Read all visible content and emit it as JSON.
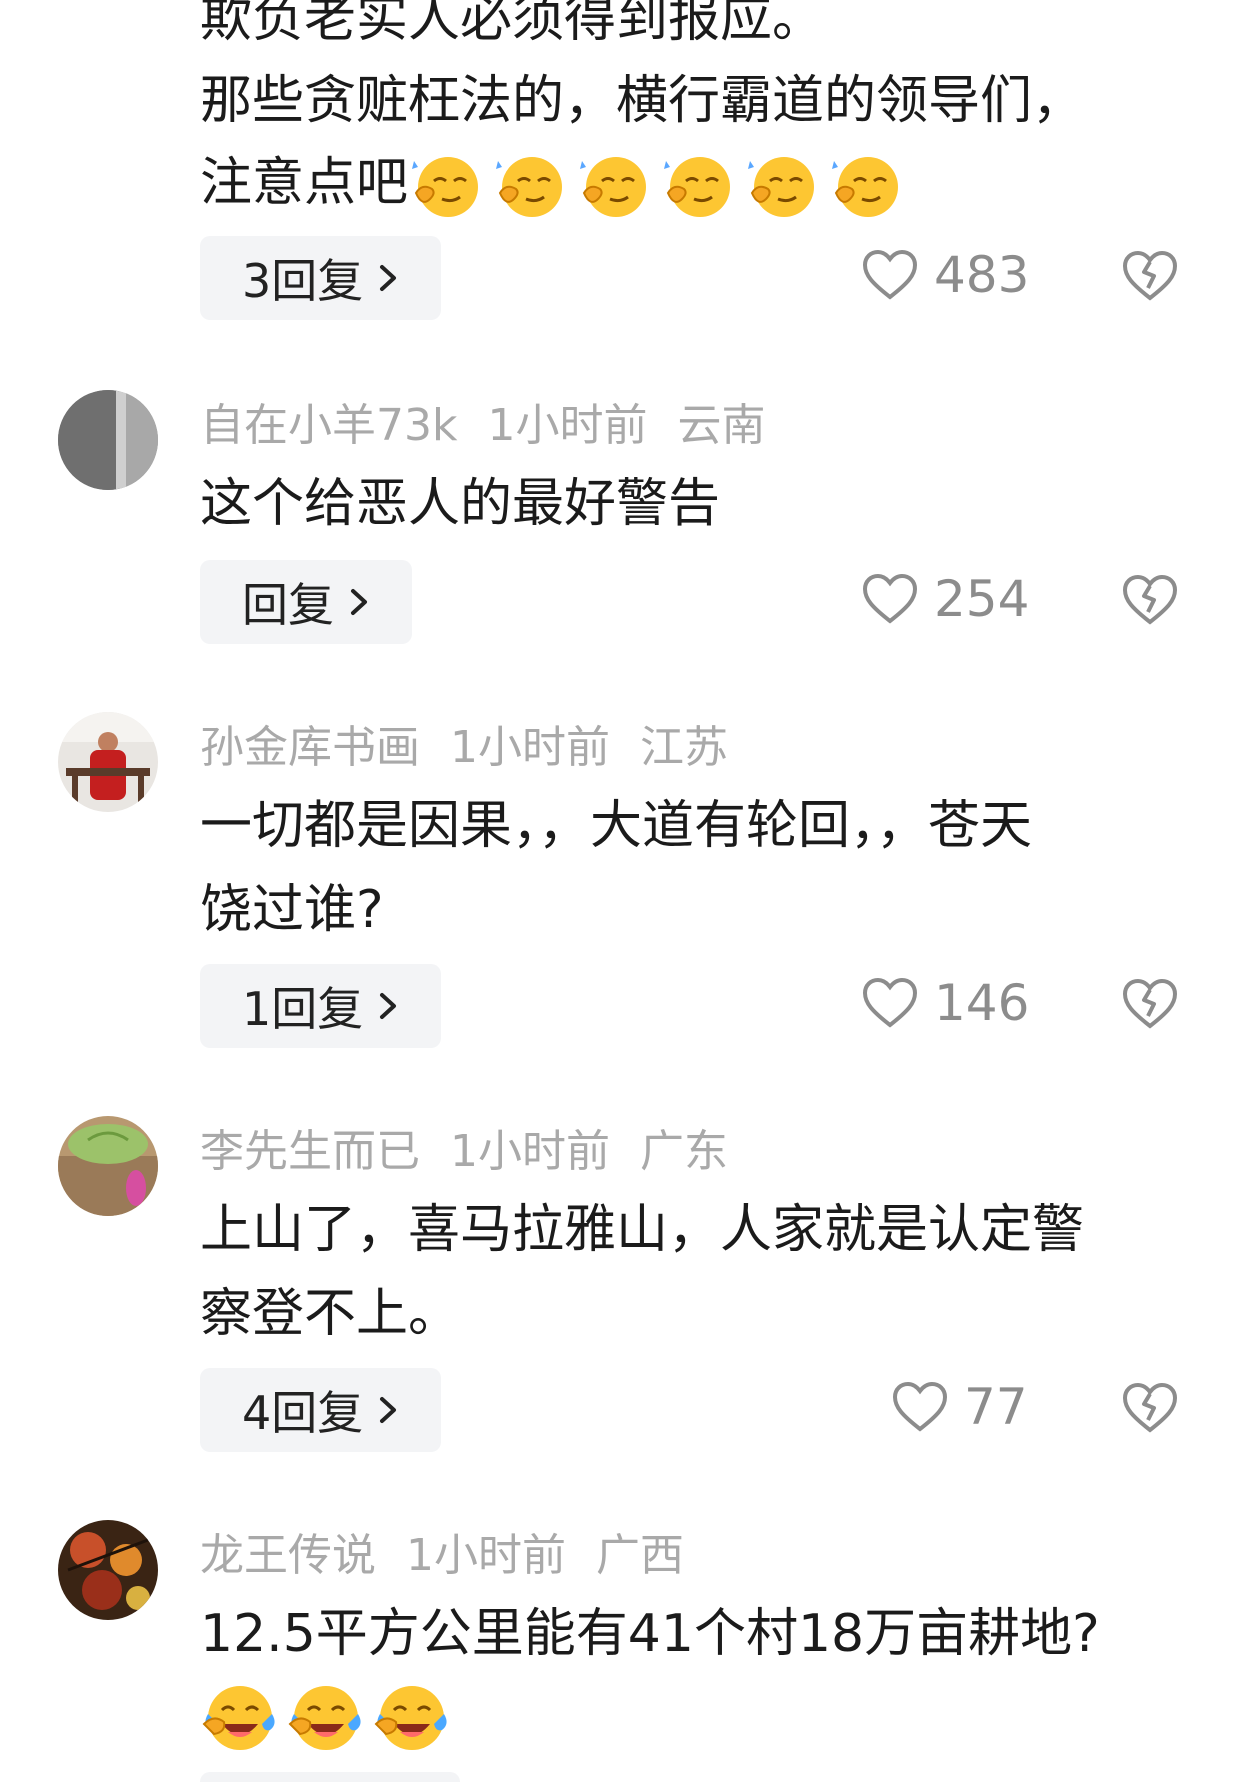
{
  "top_comment": {
    "lines": [
      "欺负老实人必须得到报应。",
      "那些贪赃枉法的，横行霸道的领导们，",
      "注意点吧"
    ],
    "emoji_name": "smirk-thinking-emoji",
    "reply_label": "3回复",
    "likes": "483"
  },
  "comments": [
    {
      "username": "自在小羊73k",
      "time": "1小时前",
      "location": "云南",
      "text_lines": [
        "这个给恶人的最好警告"
      ],
      "reply_label": "回复",
      "likes": "254"
    },
    {
      "username": "孙金库书画",
      "time": "1小时前",
      "location": "江苏",
      "text_lines": [
        "一切都是因果，，大道有轮回，，苍天",
        "饶过谁?"
      ],
      "reply_label": "1回复",
      "likes": "146"
    },
    {
      "username": "李先生而已",
      "time": "1小时前",
      "location": "广东",
      "text_lines": [
        "上山了，喜马拉雅山，人家就是认定警",
        "察登不上。"
      ],
      "reply_label": "4回复",
      "likes": "77"
    },
    {
      "username": "龙王传说",
      "time": "1小时前",
      "location": "广西",
      "text_lines": [
        "12.5平方公里能有41个村18万亩耕地?"
      ],
      "emoji_name": "laughing-crying-emoji"
    }
  ],
  "colors": {
    "meta": "#a9a9a9",
    "text": "#1b1b1b",
    "reply_bg": "#f3f4f6",
    "icon": "#8c8c8c"
  }
}
